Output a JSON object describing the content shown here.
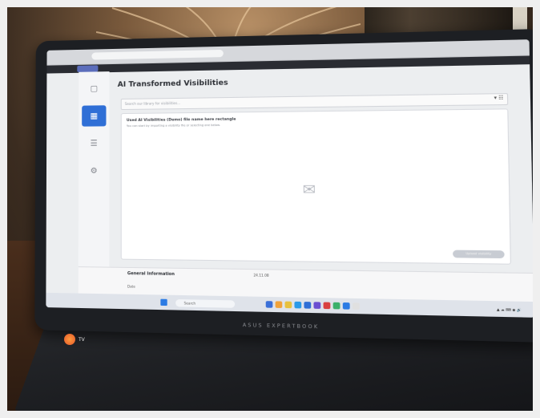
{
  "app": {
    "title": "AI Transformed Visibilities",
    "search_placeholder": "Search our library for visibilities...",
    "sort_label": "▾ ☷",
    "card_heading": "Used AI Visibilities (Demo) file name here rectangle",
    "card_subtext": "You can start by importing a visibility file or selecting one below.",
    "action_label": "Upload visibility",
    "sidebar": [
      {
        "label": "Project",
        "icon": "folder-icon",
        "glyph": "▢"
      },
      {
        "label": "Visibilities",
        "icon": "grid-icon",
        "glyph": "▦",
        "active": true
      },
      {
        "label": "Resources",
        "icon": "list-icon",
        "glyph": "☰"
      },
      {
        "label": "Settings",
        "icon": "gear-icon",
        "glyph": "⚙"
      }
    ]
  },
  "bottom_panel": {
    "title": "General Information",
    "value": "24.11.08",
    "footer": "Date"
  },
  "taskbar": {
    "search_label": "Search",
    "apps": [
      "#3a6fd8",
      "#f0a23a",
      "#e8c13d",
      "#2a9ae8",
      "#2f6fd6",
      "#6b4fd1",
      "#d94040",
      "#3ab06a",
      "#2b7be4",
      "#e0e0e0"
    ],
    "tray": "▲ ☁ ⌨ ◉ 🔊"
  },
  "brand": "ASUS EXPERTBOOK",
  "weather": "TV"
}
